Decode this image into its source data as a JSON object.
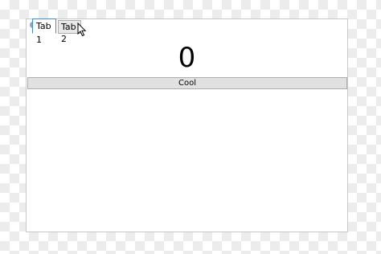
{
  "tabs": [
    {
      "label": "Tab 1",
      "selected": true
    },
    {
      "label": "Tab 2",
      "selected": false
    }
  ],
  "content": {
    "counter_value": "0",
    "button_label": "Cool"
  },
  "colors": {
    "tab_focus_border": "#3c8fd8",
    "button_bg": "#e1e1e1",
    "window_border": "#c9c9c9"
  },
  "icons": {
    "cursor": "arrow-cursor-icon"
  }
}
